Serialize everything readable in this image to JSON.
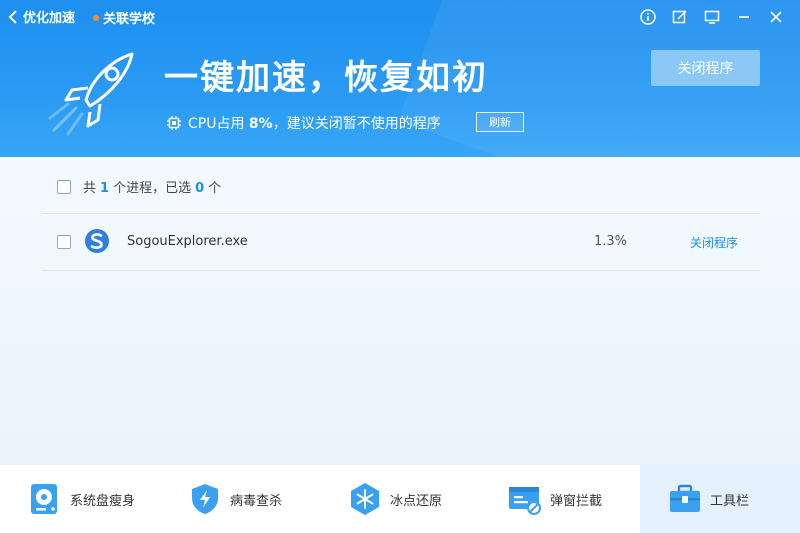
{
  "topbar": {
    "back_label": "优化加速",
    "related_label": "关联学校"
  },
  "hero": {
    "title": "一键加速，恢复如初",
    "cpu_prefix": "CPU占用 ",
    "cpu_percent": "8%",
    "cpu_suffix": "，建议关闭暂不使用的程序",
    "refresh_label": "刷新",
    "close_program_label": "关闭程序"
  },
  "summary": {
    "prefix": "共",
    "total": "1",
    "mid": "个进程，已选",
    "selected": "0",
    "suffix": "个"
  },
  "processes": [
    {
      "name": "SogouExplorer.exe",
      "cpu": "1.3%",
      "action": "关闭程序"
    }
  ],
  "toolbar": [
    {
      "label": "系统盘瘦身",
      "icon": "disk-icon"
    },
    {
      "label": "病毒查杀",
      "icon": "shield-icon"
    },
    {
      "label": "冰点还原",
      "icon": "snowflake-icon"
    },
    {
      "label": "弹窗拦截",
      "icon": "popup-block-icon"
    },
    {
      "label": "工具栏",
      "icon": "toolbox-icon",
      "active": true
    }
  ],
  "colors": {
    "header_blue": "#2a9af4",
    "accent_blue": "#1d8fe9",
    "orange_dot": "#ff8a2a"
  }
}
